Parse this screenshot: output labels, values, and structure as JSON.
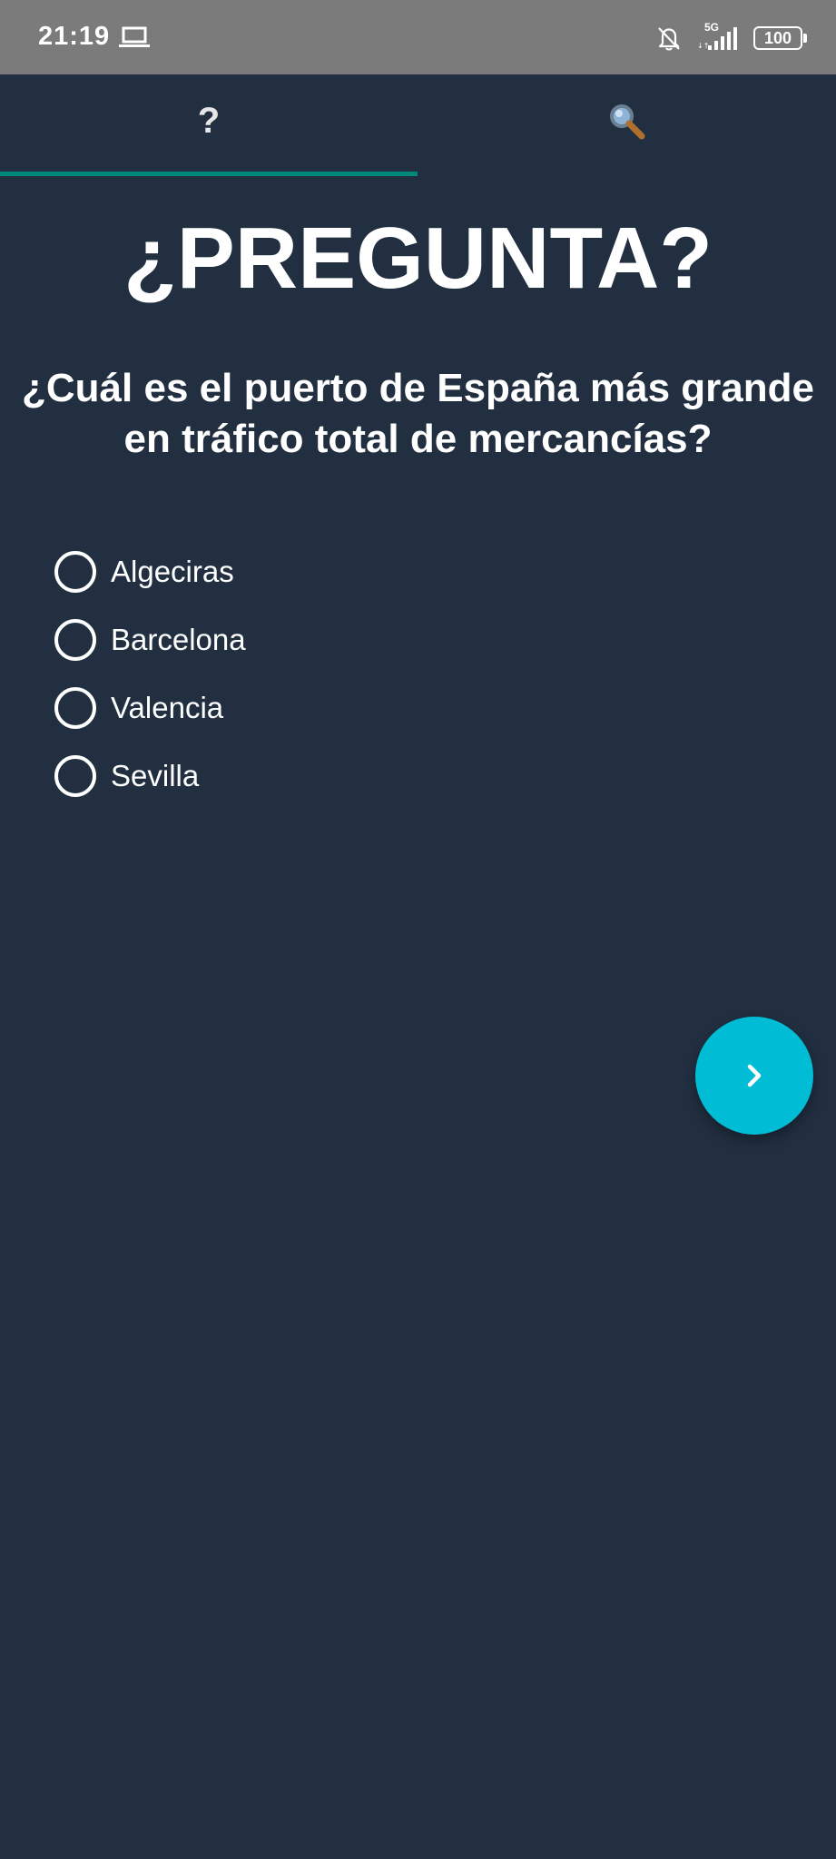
{
  "status_bar": {
    "time": "21:19",
    "network_label": "5G",
    "battery_level": "100",
    "icons": [
      "laptop-icon",
      "bell-off-icon",
      "signal-icon",
      "battery-icon"
    ]
  },
  "tabs": [
    {
      "glyph": "?",
      "icon": "question-mark-icon",
      "selected": true
    },
    {
      "glyph": "🔍",
      "icon": "magnifier-icon",
      "selected": false
    }
  ],
  "heading": "¿PREGUNTA?",
  "question": "¿Cuál es el puerto de España más grande en tráfico total de mercancías?",
  "options": [
    {
      "label": "Algeciras",
      "selected": false
    },
    {
      "label": "Barcelona",
      "selected": false
    },
    {
      "label": "Valencia",
      "selected": false
    },
    {
      "label": "Sevilla",
      "selected": false
    }
  ],
  "next_button": {
    "icon": "chevron-right-icon"
  },
  "colors": {
    "background": "#212f41",
    "status_bar": "#7b7b7b",
    "tab_indicator": "#00897b",
    "fab": "#00bcd4",
    "text": "#ffffff"
  }
}
